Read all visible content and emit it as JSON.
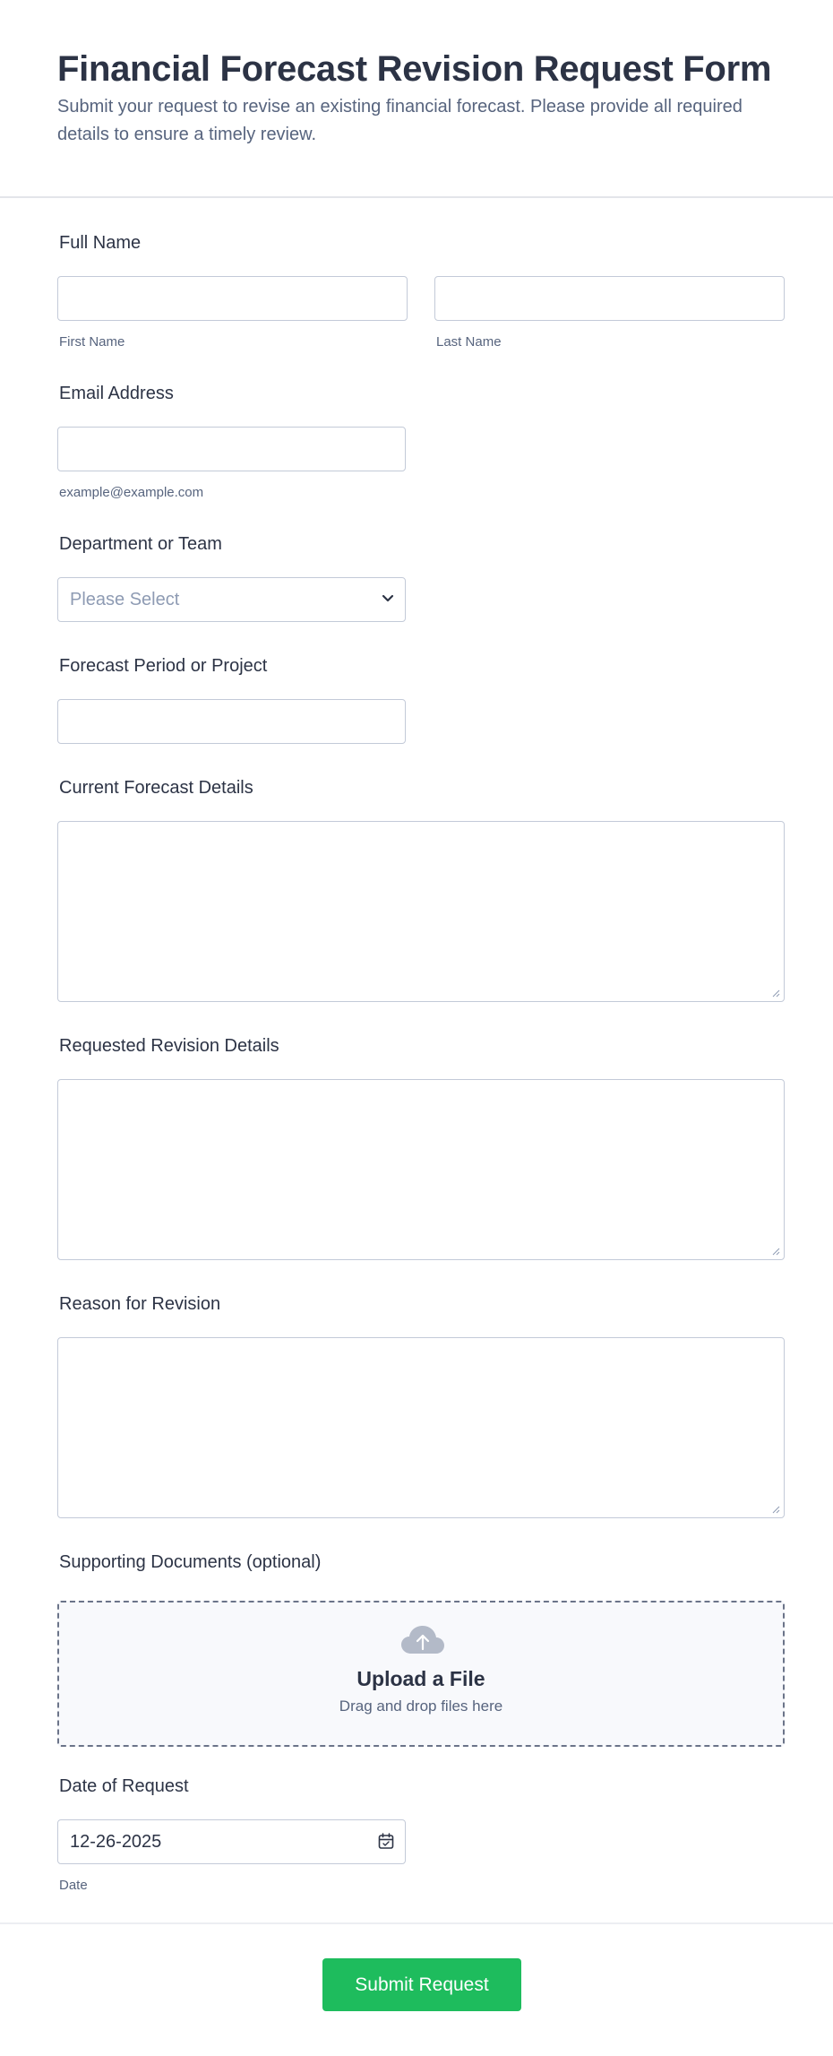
{
  "header": {
    "title": "Financial Forecast Revision Request Form",
    "subtitle": "Submit your request to revise an existing financial forecast. Please provide all required details to ensure a timely review."
  },
  "fields": {
    "full_name": {
      "label": "Full Name",
      "first_value": "",
      "last_value": "",
      "first_sublabel": "First Name",
      "last_sublabel": "Last Name"
    },
    "email": {
      "label": "Email Address",
      "value": "",
      "sublabel": "example@example.com"
    },
    "department": {
      "label": "Department or Team",
      "selected": "Please Select"
    },
    "forecast_period": {
      "label": "Forecast Period or Project",
      "value": ""
    },
    "current_forecast": {
      "label": "Current Forecast Details",
      "value": ""
    },
    "requested_revision": {
      "label": "Requested Revision Details",
      "value": ""
    },
    "reason": {
      "label": "Reason for Revision",
      "value": ""
    },
    "documents": {
      "label": "Supporting Documents (optional)",
      "upload_title": "Upload a File",
      "upload_hint": "Drag and drop files here",
      "icon": "cloud-upload-icon"
    },
    "date": {
      "label": "Date of Request",
      "value": "12-26-2025",
      "sublabel": "Date",
      "icon": "calendar-icon"
    }
  },
  "submit": {
    "label": "Submit Request",
    "color": "#1ebc5d"
  },
  "colors": {
    "text": "#2c3345",
    "muted": "#57647e",
    "border": "#c3cad8",
    "placeholder": "#8e9bb3"
  }
}
